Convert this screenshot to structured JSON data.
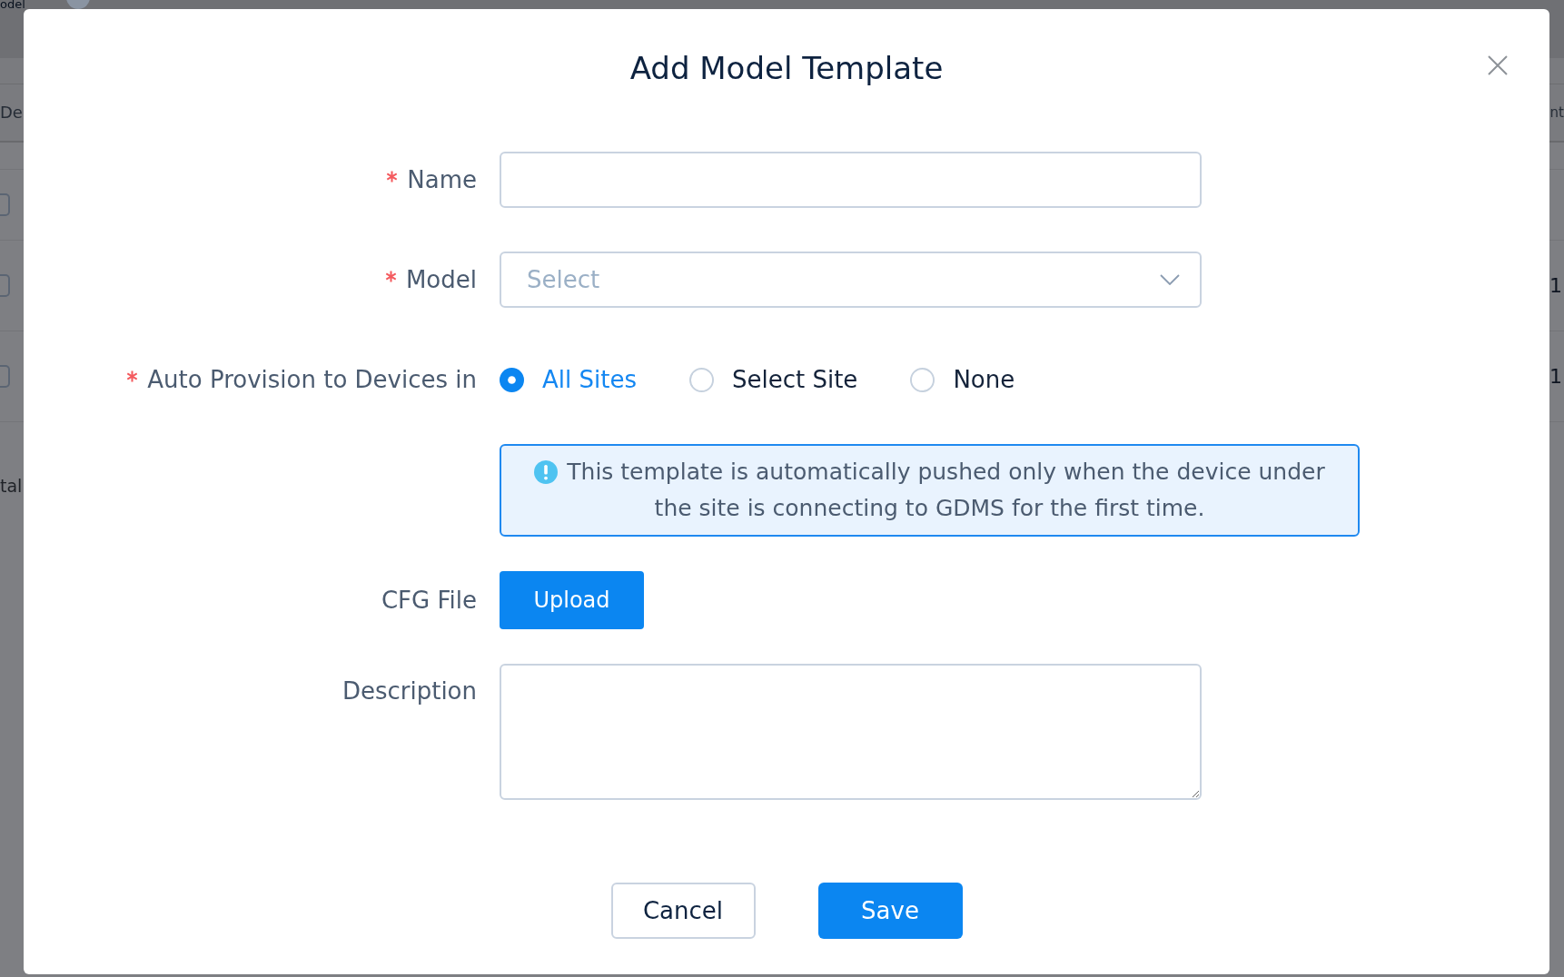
{
  "background_page": {
    "title": "odel",
    "table": {
      "columns": [
        "De",
        "nt"
      ],
      "rows": [
        {
          "checked": false
        },
        {
          "checked": false,
          "column_2": "1"
        },
        {
          "checked": false,
          "column_2": "1"
        }
      ]
    },
    "footer_text": "tal"
  },
  "dialog": {
    "title": "Add Model Template",
    "fields": [
      {
        "kind": "text",
        "label": "Name",
        "required": true
      },
      {
        "kind": "select",
        "label": "Model",
        "required": true,
        "placeholder": "Select"
      },
      {
        "kind": "radio",
        "label": "Auto Provision to Devices in",
        "required": true,
        "options": [
          {
            "label": "All Sites",
            "selected": true
          },
          {
            "label": "Select Site",
            "selected": false
          },
          {
            "label": "None",
            "selected": false
          }
        ],
        "note": "This template is automatically pushed only when the device under the site is connecting to GDMS for the first time."
      },
      {
        "kind": "upload",
        "label": "CFG File",
        "required": false,
        "button": "Upload"
      },
      {
        "kind": "textarea",
        "label": "Description",
        "required": false
      }
    ],
    "buttons": [
      {
        "kind": "secondary",
        "label": "Cancel"
      },
      {
        "kind": "primary",
        "label": "Save"
      }
    ]
  }
}
